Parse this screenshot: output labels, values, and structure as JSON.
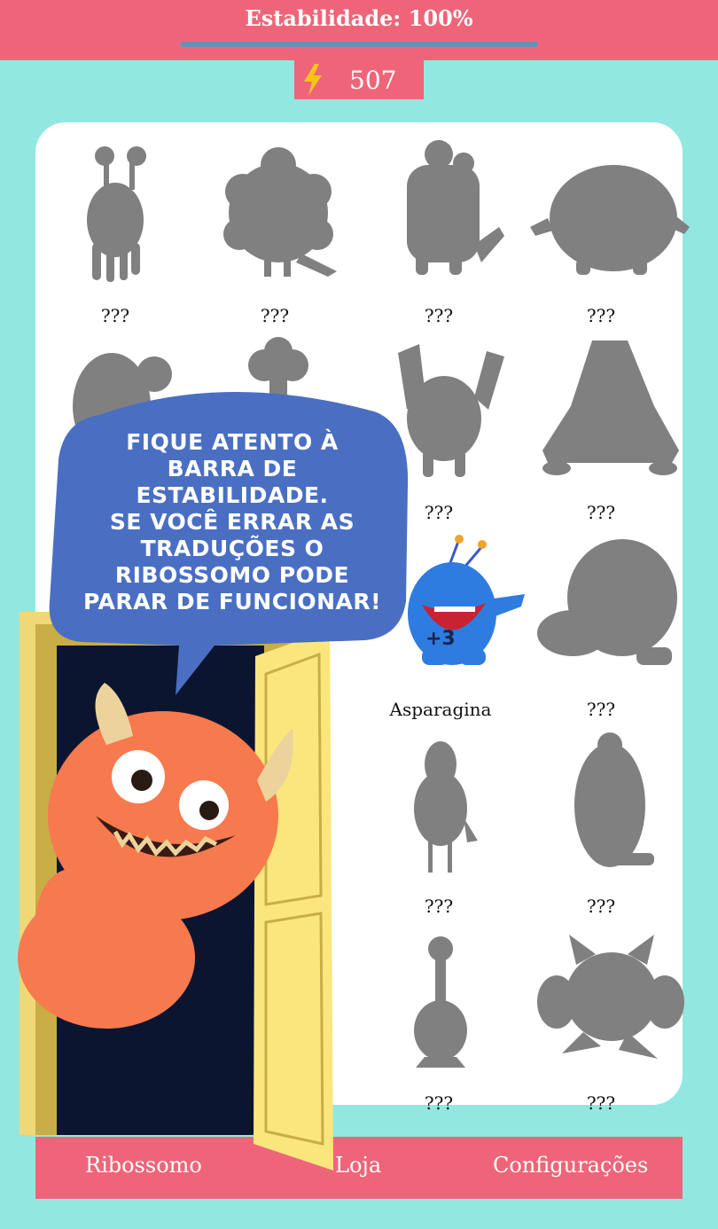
{
  "header": {
    "stability_label": "Estabilidade: 100%",
    "stability_level": 1.0
  },
  "energy": {
    "icon": "lightning-icon",
    "value": "507"
  },
  "collection": [
    {
      "name": "???",
      "unlocked": false
    },
    {
      "name": "???",
      "unlocked": false
    },
    {
      "name": "???",
      "unlocked": false
    },
    {
      "name": "???",
      "unlocked": false
    },
    {
      "name": "???",
      "unlocked": false
    },
    {
      "name": "???",
      "unlocked": false
    },
    {
      "name": "???",
      "unlocked": false
    },
    {
      "name": "???",
      "unlocked": false
    },
    {
      "name": "???",
      "unlocked": false
    },
    {
      "name": "???",
      "unlocked": false
    },
    {
      "name": "Asparagina",
      "unlocked": true,
      "badge": "+3"
    },
    {
      "name": "???",
      "unlocked": false
    },
    {
      "name": "???",
      "unlocked": false
    },
    {
      "name": "???",
      "unlocked": false
    },
    {
      "name": "???",
      "unlocked": false
    },
    {
      "name": "???",
      "unlocked": false
    },
    {
      "name": "???",
      "unlocked": false
    },
    {
      "name": "???",
      "unlocked": false
    },
    {
      "name": "???",
      "unlocked": false
    },
    {
      "name": "???",
      "unlocked": false
    }
  ],
  "tutorial": {
    "message": "FIQUE ATENTO À\nBARRA DE\nESTABILIDADE.\nSE VOCÊ ERRAR AS\nTRADUÇÕES O\nRIBOSSOMO PODE\nPARAR DE FUNCIONAR!"
  },
  "nav": {
    "ribossomo": "Ribossomo",
    "loja": "Loja",
    "configuracoes": "Configurações"
  },
  "colors": {
    "background": "#92e8e0",
    "accent": "#ee6579",
    "silhouette": "#808080",
    "bubble": "#4a6fc2"
  }
}
